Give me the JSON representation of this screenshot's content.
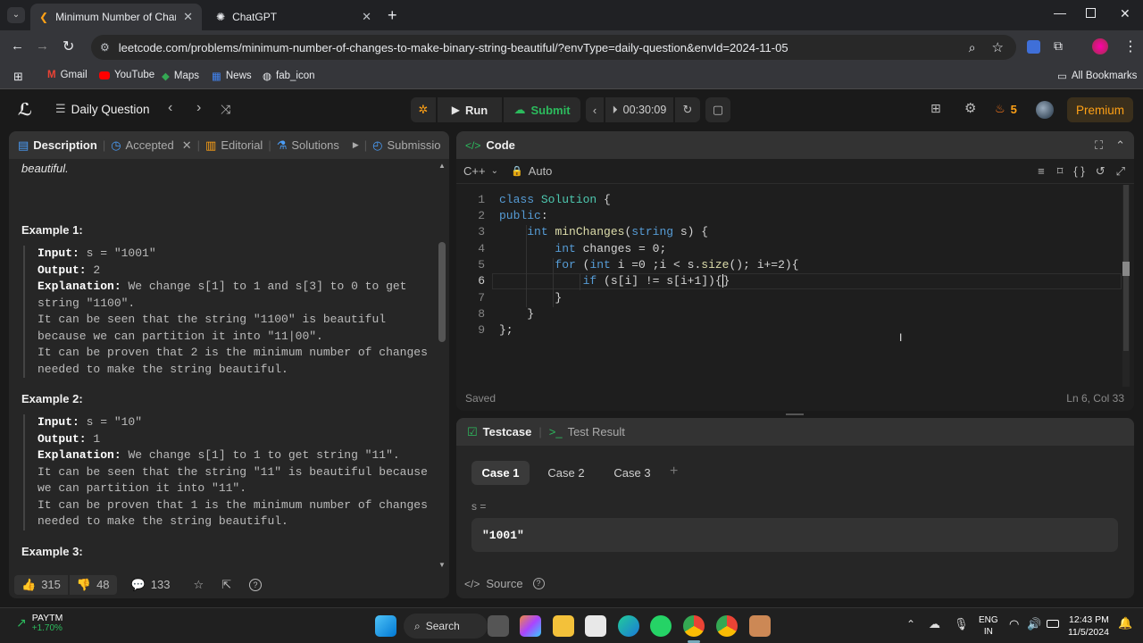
{
  "browser": {
    "tabs": [
      {
        "label": "Minimum Number of Changes T",
        "active": true
      },
      {
        "label": "ChatGPT",
        "active": false
      }
    ],
    "url": "leetcode.com/problems/minimum-number-of-changes-to-make-binary-string-beautiful/?envType=daily-question&envId=2024-11-05",
    "bookmarks": [
      "Gmail",
      "YouTube",
      "Maps",
      "News",
      "fab_icon"
    ],
    "all_bookmarks": "All Bookmarks"
  },
  "nav": {
    "daily_question": "Daily Question",
    "run": "Run",
    "submit": "Submit",
    "timer": "00:30:09",
    "streak": "5",
    "premium": "Premium"
  },
  "desc_tabs": {
    "description": "Description",
    "accepted": "Accepted",
    "editorial": "Editorial",
    "solutions": "Solutions",
    "submissions": "Submissio"
  },
  "description": {
    "intro_tail": "beautiful.",
    "examples": [
      {
        "title": "Example 1:",
        "input_label": "Input:",
        "input": "s = \"1001\"",
        "output_label": "Output:",
        "output": "2",
        "explanation_label": "Explanation:",
        "lines": [
          "We change s[1] to 1 and s[3] to 0 to get",
          "string \"1100\".",
          "It can be seen that the string \"1100\" is beautiful",
          "because we can partition it into \"11|00\".",
          "It can be proven that 2 is the minimum number of changes",
          "needed to make the string beautiful."
        ]
      },
      {
        "title": "Example 2:",
        "input_label": "Input:",
        "input": "s = \"10\"",
        "output_label": "Output:",
        "output": "1",
        "explanation_label": "Explanation:",
        "lines": [
          "We change s[1] to 1 to get string \"11\".",
          "It can be seen that the string \"11\" is beautiful because",
          "we can partition it into \"11\".",
          "It can be proven that 1 is the minimum number of changes",
          "needed to make the string beautiful."
        ]
      }
    ],
    "example3_title": "Example 3:"
  },
  "desc_footer": {
    "likes": "315",
    "dislikes": "48",
    "comments": "133"
  },
  "code": {
    "title": "Code",
    "language": "C++",
    "mode": "Auto",
    "saved": "Saved",
    "cursor": "Ln 6, Col 33",
    "line_numbers": [
      "1",
      "2",
      "3",
      "4",
      "5",
      "6",
      "7",
      "8",
      "9"
    ]
  },
  "testcase": {
    "title": "Testcase",
    "result": "Test Result",
    "cases": [
      "Case 1",
      "Case 2",
      "Case 3"
    ],
    "var_label": "s =",
    "var_value": "\"1001\"",
    "source": "Source"
  },
  "taskbar": {
    "stock_name": "PAYTM",
    "stock_change": "+1.70%",
    "search": "Search",
    "lang1": "ENG",
    "lang2": "IN",
    "time": "12:43 PM",
    "date": "11/5/2024"
  }
}
